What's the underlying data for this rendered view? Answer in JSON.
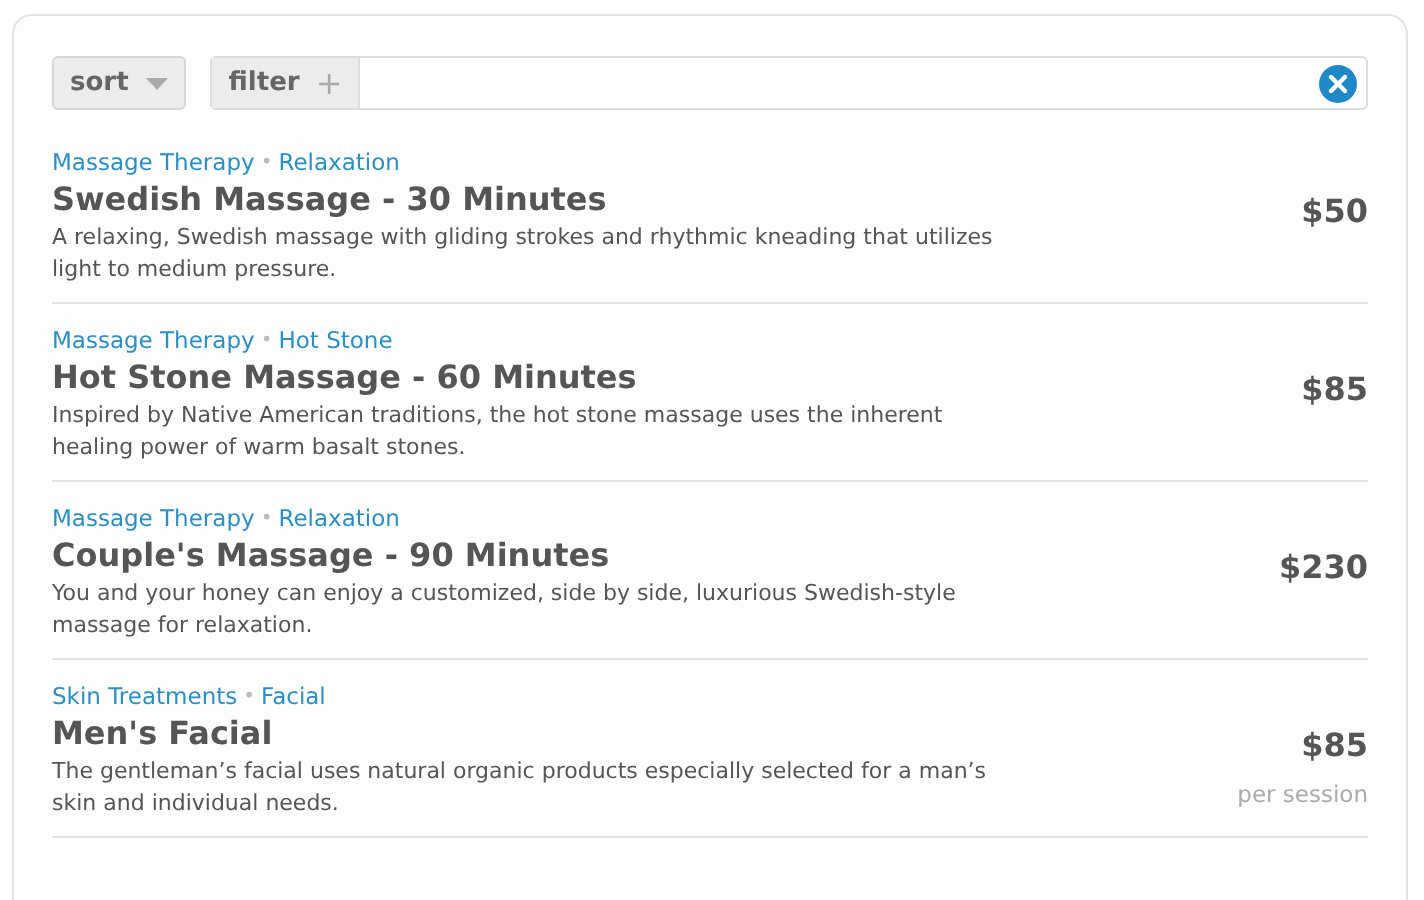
{
  "toolbar": {
    "sort_label": "sort",
    "filter_label": "filter",
    "filter_icon": "+"
  },
  "items": [
    {
      "category": "Massage Therapy",
      "separator": "•",
      "subcategory": "Relaxation",
      "title": "Swedish Massage - 30 Minutes",
      "description": "A relaxing, Swedish massage with gliding strokes and rhythmic kneading that utilizes light to medium pressure.",
      "price": "$50"
    },
    {
      "category": "Massage Therapy",
      "separator": "•",
      "subcategory": "Hot Stone",
      "title": "Hot Stone Massage - 60 Minutes",
      "description": "Inspired by Native American traditions, the hot stone massage uses the inherent healing power of warm basalt stones.",
      "price": "$85"
    },
    {
      "category": "Massage Therapy",
      "separator": "•",
      "subcategory": "Relaxation",
      "title": "Couple's Massage - 90 Minutes",
      "description": "You and your honey can enjoy a customized, side by side, luxurious Swedish-style massage for relaxation.",
      "price": "$230"
    },
    {
      "category": "Skin Treatments",
      "separator": "•",
      "subcategory": "Facial",
      "title": "Men's Facial",
      "description": "The gentleman’s facial uses natural organic products especially selected for a man’s skin and individual needs.",
      "price": "$85",
      "price_note": "per session"
    }
  ]
}
